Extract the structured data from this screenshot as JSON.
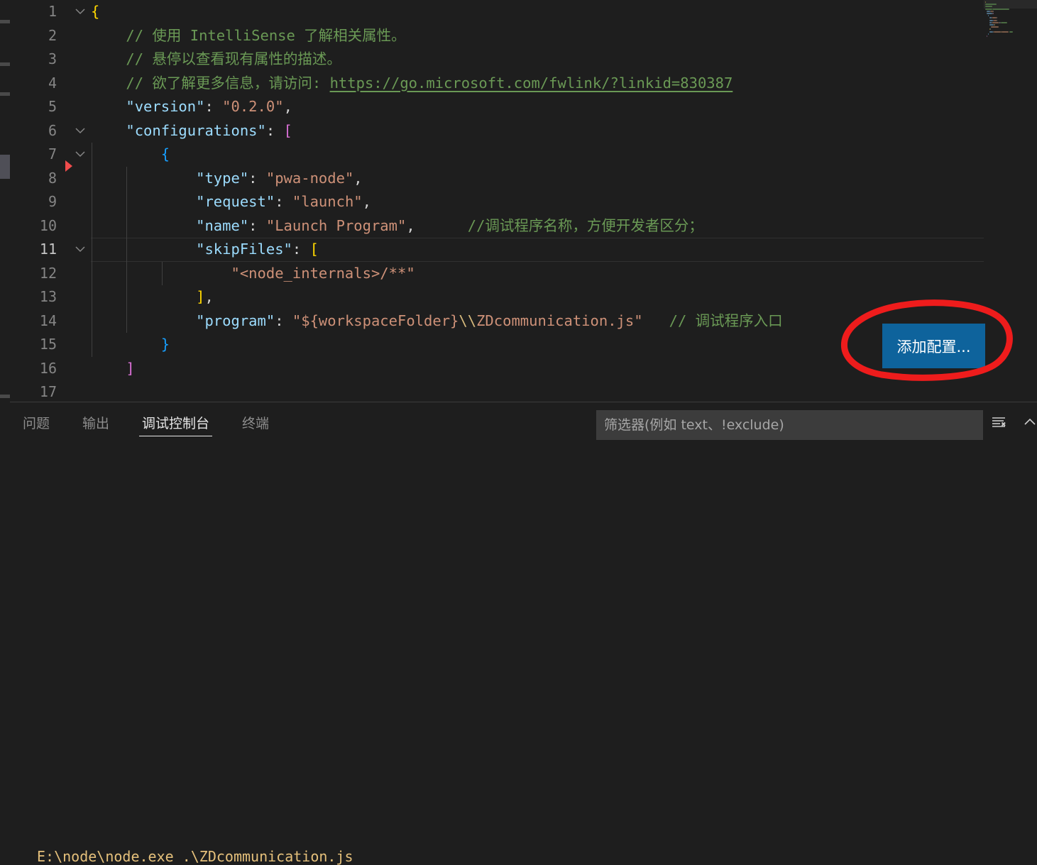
{
  "editor": {
    "file_language": "jsonc",
    "lines": [
      {
        "number": "1",
        "fold": "chevron-down-icon",
        "breakpoint": false,
        "active": false,
        "segments": [
          {
            "text": "{",
            "cls": "t-brkt1"
          }
        ]
      },
      {
        "number": "2",
        "fold": "",
        "breakpoint": false,
        "active": false,
        "segments": [
          {
            "text": "    // 使用 IntelliSense 了解相关属性。",
            "cls": "t-comment"
          }
        ]
      },
      {
        "number": "3",
        "fold": "",
        "breakpoint": false,
        "active": false,
        "segments": [
          {
            "text": "    // 悬停以查看现有属性的描述。",
            "cls": "t-comment"
          }
        ]
      },
      {
        "number": "4",
        "fold": "",
        "breakpoint": false,
        "active": false,
        "segments": [
          {
            "text": "    // 欲了解更多信息，请访问: ",
            "cls": "t-comment"
          },
          {
            "text": "https://go.microsoft.com/fwlink/?linkid=830387",
            "cls": "t-link"
          }
        ]
      },
      {
        "number": "5",
        "fold": "",
        "breakpoint": false,
        "active": false,
        "segments": [
          {
            "text": "    ",
            "cls": "t-punct"
          },
          {
            "text": "\"version\"",
            "cls": "t-key"
          },
          {
            "text": ": ",
            "cls": "t-punct"
          },
          {
            "text": "\"0.2.0\"",
            "cls": "t-str"
          },
          {
            "text": ",",
            "cls": "t-punct"
          }
        ]
      },
      {
        "number": "6",
        "fold": "chevron-down-icon",
        "breakpoint": false,
        "active": false,
        "segments": [
          {
            "text": "    ",
            "cls": "t-punct"
          },
          {
            "text": "\"configurations\"",
            "cls": "t-key"
          },
          {
            "text": ": ",
            "cls": "t-punct"
          },
          {
            "text": "[",
            "cls": "t-brkt2"
          }
        ]
      },
      {
        "number": "7",
        "fold": "chevron-down-icon",
        "breakpoint": false,
        "active": false,
        "segments": [
          {
            "text": "        ",
            "cls": "t-punct"
          },
          {
            "text": "{",
            "cls": "t-brkt3"
          }
        ]
      },
      {
        "number": "8",
        "fold": "",
        "breakpoint": true,
        "active": false,
        "segments": [
          {
            "text": "            ",
            "cls": "t-punct"
          },
          {
            "text": "\"type\"",
            "cls": "t-key"
          },
          {
            "text": ": ",
            "cls": "t-punct"
          },
          {
            "text": "\"pwa-node\"",
            "cls": "t-str"
          },
          {
            "text": ",",
            "cls": "t-punct"
          }
        ]
      },
      {
        "number": "9",
        "fold": "",
        "breakpoint": false,
        "active": false,
        "segments": [
          {
            "text": "            ",
            "cls": "t-punct"
          },
          {
            "text": "\"request\"",
            "cls": "t-key"
          },
          {
            "text": ": ",
            "cls": "t-punct"
          },
          {
            "text": "\"launch\"",
            "cls": "t-str"
          },
          {
            "text": ",",
            "cls": "t-punct"
          }
        ]
      },
      {
        "number": "10",
        "fold": "",
        "breakpoint": false,
        "active": false,
        "segments": [
          {
            "text": "            ",
            "cls": "t-punct"
          },
          {
            "text": "\"name\"",
            "cls": "t-key"
          },
          {
            "text": ": ",
            "cls": "t-punct"
          },
          {
            "text": "\"Launch Program\"",
            "cls": "t-str"
          },
          {
            "text": ",      ",
            "cls": "t-punct"
          },
          {
            "text": "//调试程序名称，方便开发者区分；",
            "cls": "t-comment"
          }
        ]
      },
      {
        "number": "11",
        "fold": "chevron-down-icon",
        "breakpoint": false,
        "active": true,
        "segments": [
          {
            "text": "            ",
            "cls": "t-punct"
          },
          {
            "text": "\"skipFiles\"",
            "cls": "t-key"
          },
          {
            "text": ": ",
            "cls": "t-punct"
          },
          {
            "text": "[",
            "cls": "t-brkt1"
          }
        ]
      },
      {
        "number": "12",
        "fold": "",
        "breakpoint": false,
        "active": false,
        "segments": [
          {
            "text": "                ",
            "cls": "t-punct"
          },
          {
            "text": "\"<node_internals>/**\"",
            "cls": "t-str"
          }
        ]
      },
      {
        "number": "13",
        "fold": "",
        "breakpoint": false,
        "active": false,
        "segments": [
          {
            "text": "            ",
            "cls": "t-punct"
          },
          {
            "text": "]",
            "cls": "t-brkt1"
          },
          {
            "text": ",",
            "cls": "t-punct"
          }
        ]
      },
      {
        "number": "14",
        "fold": "",
        "breakpoint": false,
        "active": false,
        "segments": [
          {
            "text": "            ",
            "cls": "t-punct"
          },
          {
            "text": "\"program\"",
            "cls": "t-key"
          },
          {
            "text": ": ",
            "cls": "t-punct"
          },
          {
            "text": "\"${workspaceFolder}",
            "cls": "t-str"
          },
          {
            "text": "\\\\",
            "cls": "t-esc"
          },
          {
            "text": "ZDcommunication.js\"",
            "cls": "t-str"
          },
          {
            "text": "   ",
            "cls": "t-punct"
          },
          {
            "text": "// 调试程序入口",
            "cls": "t-comment"
          }
        ]
      },
      {
        "number": "15",
        "fold": "",
        "breakpoint": false,
        "active": false,
        "segments": [
          {
            "text": "        ",
            "cls": "t-punct"
          },
          {
            "text": "}",
            "cls": "t-brkt3"
          }
        ]
      },
      {
        "number": "16",
        "fold": "",
        "breakpoint": false,
        "active": false,
        "segments": [
          {
            "text": "    ",
            "cls": "t-punct"
          },
          {
            "text": "]",
            "cls": "t-brkt2"
          }
        ]
      },
      {
        "number": "17",
        "fold": "",
        "breakpoint": false,
        "active": false,
        "segments": []
      }
    ],
    "add_config_button": "添加配置..."
  },
  "panel": {
    "tabs": [
      {
        "label": "问题",
        "active": false
      },
      {
        "label": "输出",
        "active": false
      },
      {
        "label": "调试控制台",
        "active": true
      },
      {
        "label": "终端",
        "active": false
      }
    ],
    "filter": {
      "value": "",
      "placeholder": "筛选器(例如 text、!exclude)"
    },
    "actions": [
      {
        "name": "clear-console-icon"
      },
      {
        "name": "chevron-up-icon"
      }
    ],
    "console_output": "E:\\node\\node.exe .\\ZDcommunication.js"
  },
  "colors": {
    "editor_background": "#1e1e1e",
    "comment": "#6a9955",
    "property_key": "#9cdcfe",
    "string_value": "#ce9178",
    "button_background": "#0e639c",
    "annotation_red": "#ee1c1c",
    "breakpoint_red": "#f14c4c",
    "console_text": "#e5c07b"
  }
}
